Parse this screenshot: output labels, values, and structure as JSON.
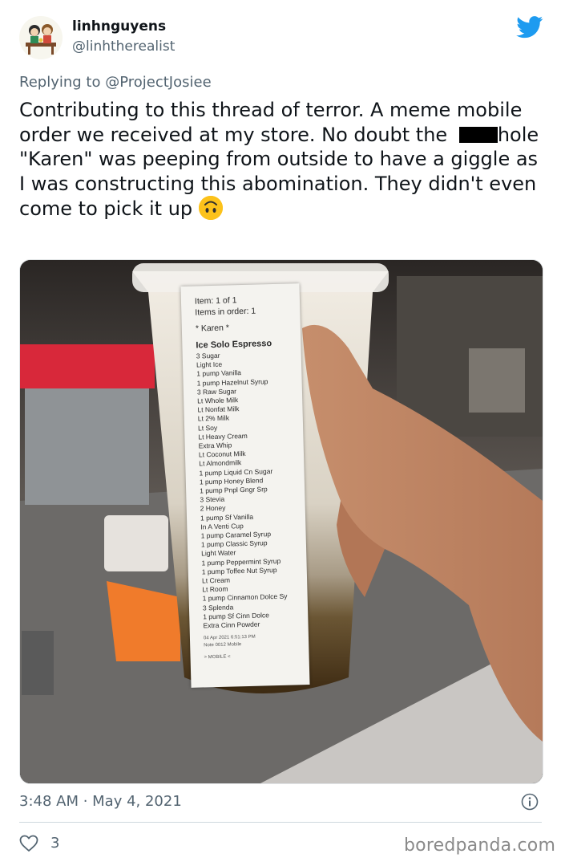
{
  "author": {
    "name": "linhnguyens",
    "handle": "@linhtherealist"
  },
  "reply": {
    "prefix": "Replying to ",
    "mention": "@ProjectJosiee"
  },
  "tweet": {
    "text_before": "Contributing to this thread of terror. A meme mobile order we received at my store. No doubt the ",
    "text_after": "hole \"Karen\" was peeping from outside to have a giggle as I was constructing this abomination. They didn't even come to pick it up ",
    "emoji": "upside-down-face-emoji"
  },
  "receipt": {
    "item_line": "Item: 1 of 1",
    "items_in_order": "Items in order: 1",
    "customer": "* Karen *",
    "drink": "Ice Solo Espresso",
    "mods": [
      "3 Sugar",
      "Light Ice",
      "1 pump Vanilla",
      "1 pump Hazelnut Syrup",
      "3 Raw Sugar",
      "Lt Whole Milk",
      "Lt Nonfat Milk",
      "Lt 2% Milk",
      "Lt Soy",
      "Lt Heavy Cream",
      "Extra Whip",
      "Lt Coconut Milk",
      "Lt Almondmilk",
      "1 pump Liquid Cn Sugar",
      "1 pump Honey Blend",
      "1 pump Pnpl Gngr Srp",
      "3 Stevia",
      "2 Honey",
      "1 pump Sf Vanilla",
      "In A Venti Cup",
      "1 pump Caramel Syrup",
      "1 pump Classic Syrup",
      "Light Water",
      "1 pump Peppermint Syrup",
      "1 pump Toffee Nut Syrup",
      "Lt Cream",
      "Lt Room",
      "1 pump Cinnamon Dolce Sy",
      "3 Splenda",
      "1 pump Sf Cinn Dolce",
      "Extra Cinn Powder"
    ],
    "footer_tiny": "04 Apr 2021   6:51:13 PM",
    "footer_tiny2": "Note 0012   Mobile",
    "mobile": "> MOBILE <"
  },
  "meta": {
    "timestamp": "3:48 AM · May 4, 2021",
    "likes": "3"
  },
  "watermark": "boredpanda.com",
  "icons": {
    "brand": "twitter-bird-icon",
    "info": "info-icon",
    "like": "heart-icon"
  },
  "colors": {
    "twitter_blue": "#1d9bf0",
    "text": "#0f1419",
    "muted": "#536471"
  }
}
